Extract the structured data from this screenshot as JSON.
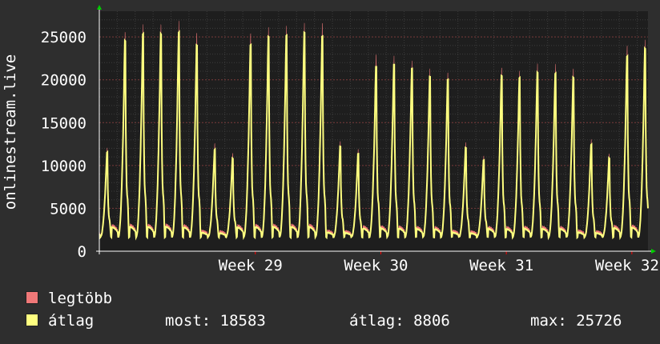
{
  "chart_data": {
    "type": "area",
    "ylabel": "onlinestream.live",
    "ylim": [
      0,
      28000
    ],
    "yticks": [
      0,
      5000,
      10000,
      15000,
      20000,
      25000
    ],
    "grid": true,
    "xticks": [
      {
        "label": "Week 29",
        "pos": 8.7
      },
      {
        "label": "Week 30",
        "pos": 15.7
      },
      {
        "label": "Week 31",
        "pos": 22.7
      },
      {
        "label": "Week 32",
        "pos": 29.7
      }
    ],
    "x_range": [
      0,
      30.6
    ],
    "daily_peaks": [
      {
        "max": 12000,
        "avg": 11500
      },
      {
        "max": 25500,
        "avg": 24500
      },
      {
        "max": 26400,
        "avg": 25300
      },
      {
        "max": 26400,
        "avg": 25300
      },
      {
        "max": 26800,
        "avg": 25500
      },
      {
        "max": 25400,
        "avg": 24000
      },
      {
        "max": 12500,
        "avg": 11800
      },
      {
        "max": 11400,
        "avg": 10800
      },
      {
        "max": 25300,
        "avg": 24000
      },
      {
        "max": 26100,
        "avg": 25000
      },
      {
        "max": 26200,
        "avg": 25100
      },
      {
        "max": 26600,
        "avg": 25500
      },
      {
        "max": 26500,
        "avg": 25000
      },
      {
        "max": 12800,
        "avg": 12200
      },
      {
        "max": 11800,
        "avg": 11300
      },
      {
        "max": 22900,
        "avg": 21500
      },
      {
        "max": 22700,
        "avg": 21700
      },
      {
        "max": 22200,
        "avg": 21300
      },
      {
        "max": 21200,
        "avg": 20300
      },
      {
        "max": 20800,
        "avg": 20000
      },
      {
        "max": 12600,
        "avg": 12000
      },
      {
        "max": 11100,
        "avg": 10600
      },
      {
        "max": 21300,
        "avg": 20400
      },
      {
        "max": 21000,
        "avg": 20200
      },
      {
        "max": 21800,
        "avg": 20800
      },
      {
        "max": 21800,
        "avg": 20700
      },
      {
        "max": 21200,
        "avg": 20200
      },
      {
        "max": 13000,
        "avg": 12400
      },
      {
        "max": 11300,
        "avg": 10800
      },
      {
        "max": 23900,
        "avg": 22700
      },
      {
        "max": 24600,
        "avg": 23600
      }
    ],
    "daily_min": 2000,
    "series": [
      {
        "name": "legtöbb",
        "color": "#f07878"
      },
      {
        "name": "átlag",
        "color": "#ffff80"
      }
    ]
  },
  "legend": {
    "max_label": "legtöbb",
    "avg_label": "átlag"
  },
  "stats": {
    "current": "most: 18583",
    "average": "átlag: 8806",
    "maximum": "max: 25726"
  }
}
